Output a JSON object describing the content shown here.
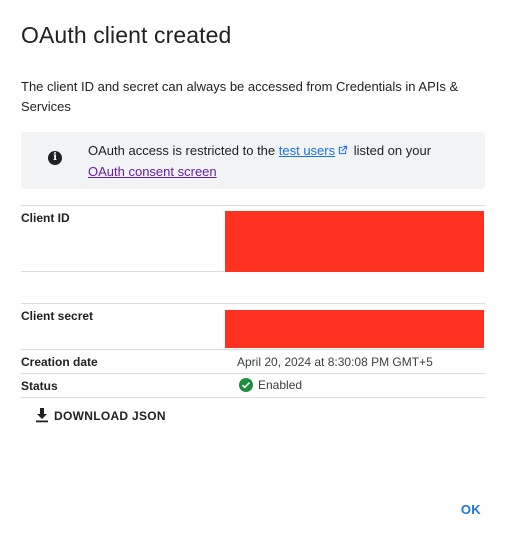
{
  "dialog": {
    "title": "OAuth client created",
    "description": "The client ID and secret can always be accessed from Credentials in APIs & Services"
  },
  "notice": {
    "icon": "info-icon",
    "text_before": "OAuth access is restricted to the ",
    "test_users_link": "test users",
    "link_icon": "external-link-icon",
    "text_after": " listed on your",
    "consent_link": "OAuth consent screen"
  },
  "fields": {
    "client_id_label": "Client ID",
    "client_secret_label": "Client secret",
    "creation_date_label": "Creation date",
    "creation_date_value": "April 20, 2024 at 8:30:08 PM GMT+5",
    "status_label": "Status",
    "status_value": "Enabled",
    "status_icon": "check-circle-icon"
  },
  "actions": {
    "download_icon": "download-icon",
    "download_label": "DOWNLOAD JSON",
    "ok_label": "OK"
  },
  "colors": {
    "link": "#1a73e8",
    "visited_link": "#681da8",
    "status_green": "#1e8e3e",
    "redaction": "#ff3120"
  }
}
